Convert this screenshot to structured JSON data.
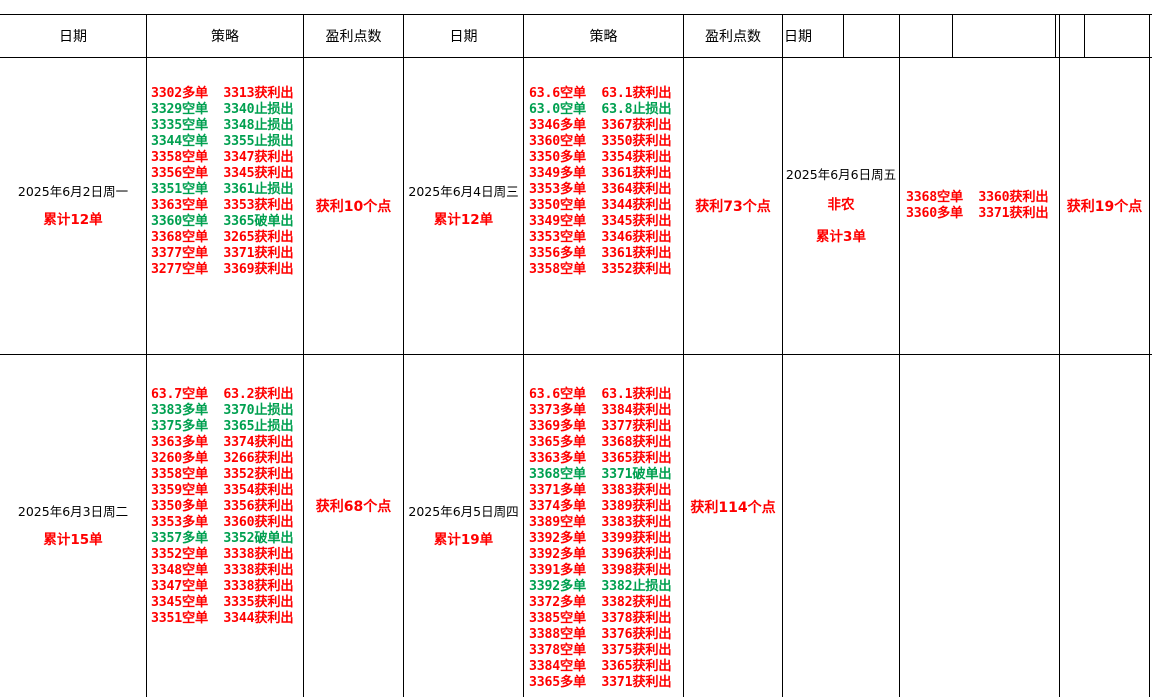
{
  "colors": {
    "red": "#ff0000",
    "green": "#00a050"
  },
  "headers": {
    "col1_date": "日期",
    "col1_strategy": "策略",
    "col1_profit": "盈利点数",
    "col2_date": "日期",
    "col2_strategy": "策略",
    "col2_profit": "盈利点数",
    "col3_date": "日期"
  },
  "days": {
    "d2": {
      "date": "2025年6月2日周一",
      "total": "累计12单",
      "profit": "获利10个点"
    },
    "d3": {
      "date": "2025年6月3日周二",
      "total": "累计15单",
      "profit": "获利68个点"
    },
    "d4": {
      "date": "2025年6月4日周三",
      "total": "累计12单",
      "profit": "获利73个点"
    },
    "d5": {
      "date": "2025年6月5日周四",
      "total": "累计19单",
      "profit": "获利114个点"
    },
    "d6": {
      "date": "2025年6月6日周五",
      "note": "非农",
      "total": "累计3单",
      "profit": "获利19个点"
    }
  },
  "strategies": {
    "d2": [
      {
        "text": "3302多单  3313获利出",
        "color": "red"
      },
      {
        "text": "3329空单  3340止损出",
        "color": "green"
      },
      {
        "text": "3335空单  3348止损出",
        "color": "green"
      },
      {
        "text": "3344空单  3355止损出",
        "color": "green"
      },
      {
        "text": "3358空单  3347获利出",
        "color": "red"
      },
      {
        "text": "3356空单  3345获利出",
        "color": "red"
      },
      {
        "text": "3351空单  3361止损出",
        "color": "green"
      },
      {
        "text": "3363空单  3353获利出",
        "color": "red"
      },
      {
        "text": "3360空单  3365破单出",
        "color": "green"
      },
      {
        "text": "3368空单  3265获利出",
        "color": "red"
      },
      {
        "text": "3377空单  3371获利出",
        "color": "red"
      },
      {
        "text": "3277空单  3369获利出",
        "color": "red"
      }
    ],
    "d3": [
      {
        "text": "63.7空单  63.2获利出",
        "color": "red"
      },
      {
        "text": "3383多单  3370止损出",
        "color": "green"
      },
      {
        "text": "3375多单  3365止损出",
        "color": "green"
      },
      {
        "text": "3363多单  3374获利出",
        "color": "red"
      },
      {
        "text": "3260多单  3266获利出",
        "color": "red"
      },
      {
        "text": "3358空单  3352获利出",
        "color": "red"
      },
      {
        "text": "3359空单  3354获利出",
        "color": "red"
      },
      {
        "text": "3350多单  3356获利出",
        "color": "red"
      },
      {
        "text": "3353多单  3360获利出",
        "color": "red"
      },
      {
        "text": "3357多单  3352破单出",
        "color": "green"
      },
      {
        "text": "3352空单  3338获利出",
        "color": "red"
      },
      {
        "text": "3348空单  3338获利出",
        "color": "red"
      },
      {
        "text": "3347空单  3338获利出",
        "color": "red"
      },
      {
        "text": "3345空单  3335获利出",
        "color": "red"
      },
      {
        "text": "3351空单  3344获利出",
        "color": "red"
      }
    ],
    "d4": [
      {
        "text": "63.6空单  63.1获利出",
        "color": "red"
      },
      {
        "text": "63.0空单  63.8止损出",
        "color": "green"
      },
      {
        "text": "3346多单  3367获利出",
        "color": "red"
      },
      {
        "text": "3360空单  3350获利出",
        "color": "red"
      },
      {
        "text": "3350多单  3354获利出",
        "color": "red"
      },
      {
        "text": "3349多单  3361获利出",
        "color": "red"
      },
      {
        "text": "3353多单  3364获利出",
        "color": "red"
      },
      {
        "text": "3350空单  3344获利出",
        "color": "red"
      },
      {
        "text": "3349空单  3345获利出",
        "color": "red"
      },
      {
        "text": "3353空单  3346获利出",
        "color": "red"
      },
      {
        "text": "3356多单  3361获利出",
        "color": "red"
      },
      {
        "text": "3358空单  3352获利出",
        "color": "red"
      }
    ],
    "d5": [
      {
        "text": "63.6空单  63.1获利出",
        "color": "red"
      },
      {
        "text": "3373多单  3384获利出",
        "color": "red"
      },
      {
        "text": "3369多单  3377获利出",
        "color": "red"
      },
      {
        "text": "3365多单  3368获利出",
        "color": "red"
      },
      {
        "text": "3363多单  3365获利出",
        "color": "red"
      },
      {
        "text": "3368空单  3371破单出",
        "color": "green"
      },
      {
        "text": "3371多单  3383获利出",
        "color": "red"
      },
      {
        "text": "3374多单  3389获利出",
        "color": "red"
      },
      {
        "text": "3389空单  3383获利出",
        "color": "red"
      },
      {
        "text": "3392多单  3399获利出",
        "color": "red"
      },
      {
        "text": "3392多单  3396获利出",
        "color": "red"
      },
      {
        "text": "3391多单  3398获利出",
        "color": "red"
      },
      {
        "text": "3392多单  3382止损出",
        "color": "green"
      },
      {
        "text": "3372多单  3382获利出",
        "color": "red"
      },
      {
        "text": "3385空单  3378获利出",
        "color": "red"
      },
      {
        "text": "3388空单  3376获利出",
        "color": "red"
      },
      {
        "text": "3378空单  3375获利出",
        "color": "red"
      },
      {
        "text": "3384空单  3365获利出",
        "color": "red"
      },
      {
        "text": "3365多单  3371获利出",
        "color": "red"
      }
    ],
    "d6": [
      {
        "text": "3368空单  3360获利出",
        "color": "red"
      },
      {
        "text": "3360多单  3371获利出",
        "color": "red"
      }
    ]
  }
}
